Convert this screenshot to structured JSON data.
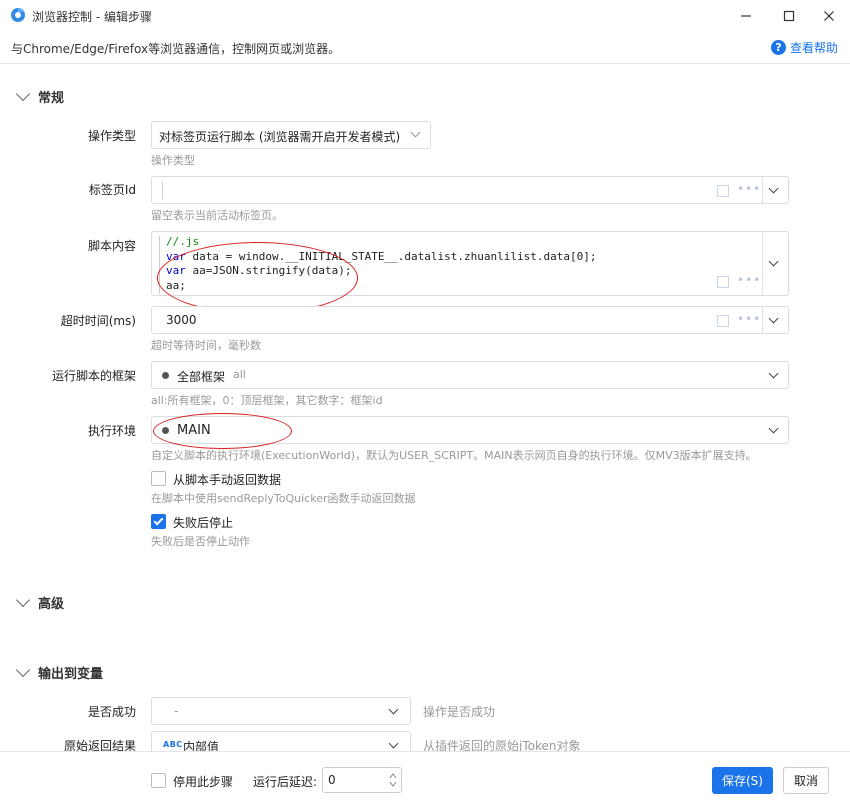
{
  "window": {
    "title": "浏览器控制 - 编辑步骤",
    "description": "与Chrome/Edge/Firefox等浏览器通信，控制网页或浏览器。",
    "help_label": "查看帮助",
    "help_icon": "question-circle-icon"
  },
  "sections": {
    "general": "常规",
    "advanced": "高级",
    "output": "输出到变量"
  },
  "fields": {
    "op_type": {
      "label": "操作类型",
      "value": "对标签页运行脚本 (浏览器需开启开发者模式)",
      "hint": "操作类型"
    },
    "tab_id": {
      "label": "标签页Id",
      "value": "",
      "hint": "留空表示当前活动标签页。"
    },
    "script": {
      "label": "脚本内容",
      "line1": "//.js",
      "line2_kw": "var",
      "line2_rest": " data = window.__INITIAL_STATE__.datalist.zhuanlilist.data[0];",
      "line3_kw": "var",
      "line3_rest": " aa=JSON.stringify(data);",
      "line4": "aa;"
    },
    "timeout": {
      "label": "超时时间(ms)",
      "value": "3000",
      "hint": "超时等待时间，毫秒数"
    },
    "frame": {
      "label": "运行脚本的框架",
      "value": "全部框架",
      "sub": "all",
      "hint": "all:所有框架，0：顶层框架，其它数字：框架id"
    },
    "env": {
      "label": "执行环境",
      "value": "MAIN",
      "hint": "自定义脚本的执行环境(ExecutionWorld)，默认为USER_SCRIPT。MAIN表示网页自身的执行环境。仅MV3版本扩展支持。"
    },
    "manual_return": {
      "label": "从脚本手动返回数据",
      "hint": "在脚本中使用sendReplyToQuicker函数手动返回数据",
      "checked": false
    },
    "stop_on_fail": {
      "label": "失败后停止",
      "hint": "失败后是否停止动作",
      "checked": true
    },
    "success": {
      "label": "是否成功",
      "value": "-",
      "hint": "操作是否成功"
    },
    "raw_result": {
      "label": "原始返回结果",
      "badge": "ABC",
      "value": "内部值",
      "hint": "从插件返回的原始jToken对象"
    }
  },
  "footer": {
    "disable_label": "停用此步骤",
    "delay_label": "运行后延迟:",
    "delay_value": "0",
    "save_label": "保存(S)",
    "cancel_label": "取消"
  },
  "colors": {
    "accent": "#1a73e8",
    "annotation": "#d81e1e"
  }
}
